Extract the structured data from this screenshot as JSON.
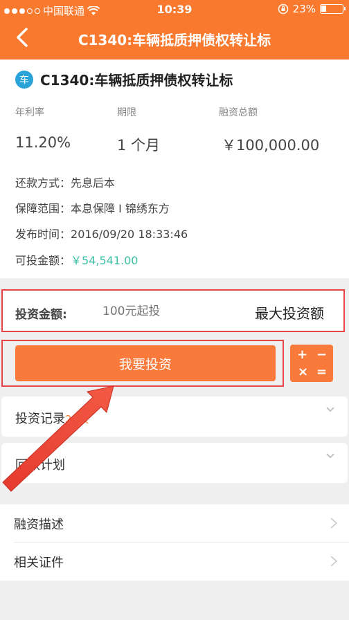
{
  "status_bar": {
    "carrier": "中国联通",
    "time": "10:39",
    "battery": "23%"
  },
  "nav": {
    "title": "C1340:车辆抵质押债权转让标"
  },
  "loan": {
    "badge": "车",
    "title": "C1340:车辆抵质押债权转让标",
    "columns": [
      {
        "label": "年利率",
        "value": "11.20%"
      },
      {
        "label": "期限",
        "value": "1 个月"
      },
      {
        "label": "融资总额",
        "value": "￥100,000.00"
      }
    ],
    "repayment_label": "还款方式：",
    "repayment_value": "先息后本",
    "guarantee_label": "保障范围：",
    "guarantee_value": "本息保障 I 锦绣东方",
    "published_label": "发布时间：",
    "published_value": "2016/09/20 18:33:46",
    "available_label": "可投金额：",
    "available_value": "￥54,541.00"
  },
  "invest": {
    "label": "投资金额:",
    "placeholder": "100元起投",
    "max_button": "最大投资额",
    "submit_button": "我要投资"
  },
  "calculator": {
    "symbols": [
      "+",
      "−",
      "×",
      "="
    ]
  },
  "sections": [
    {
      "label": "投资记录",
      "count": "26人"
    },
    {
      "label": "回款计划",
      "count": ""
    }
  ],
  "list": [
    {
      "label": "融资描述"
    },
    {
      "label": "相关证件"
    }
  ],
  "colors": {
    "brand_orange": "#f97a2f",
    "button_orange": "#f97a3a",
    "highlight_red": "#e64545",
    "amount_green": "#3bbfa5",
    "badge_blue": "#2aa3d9"
  }
}
